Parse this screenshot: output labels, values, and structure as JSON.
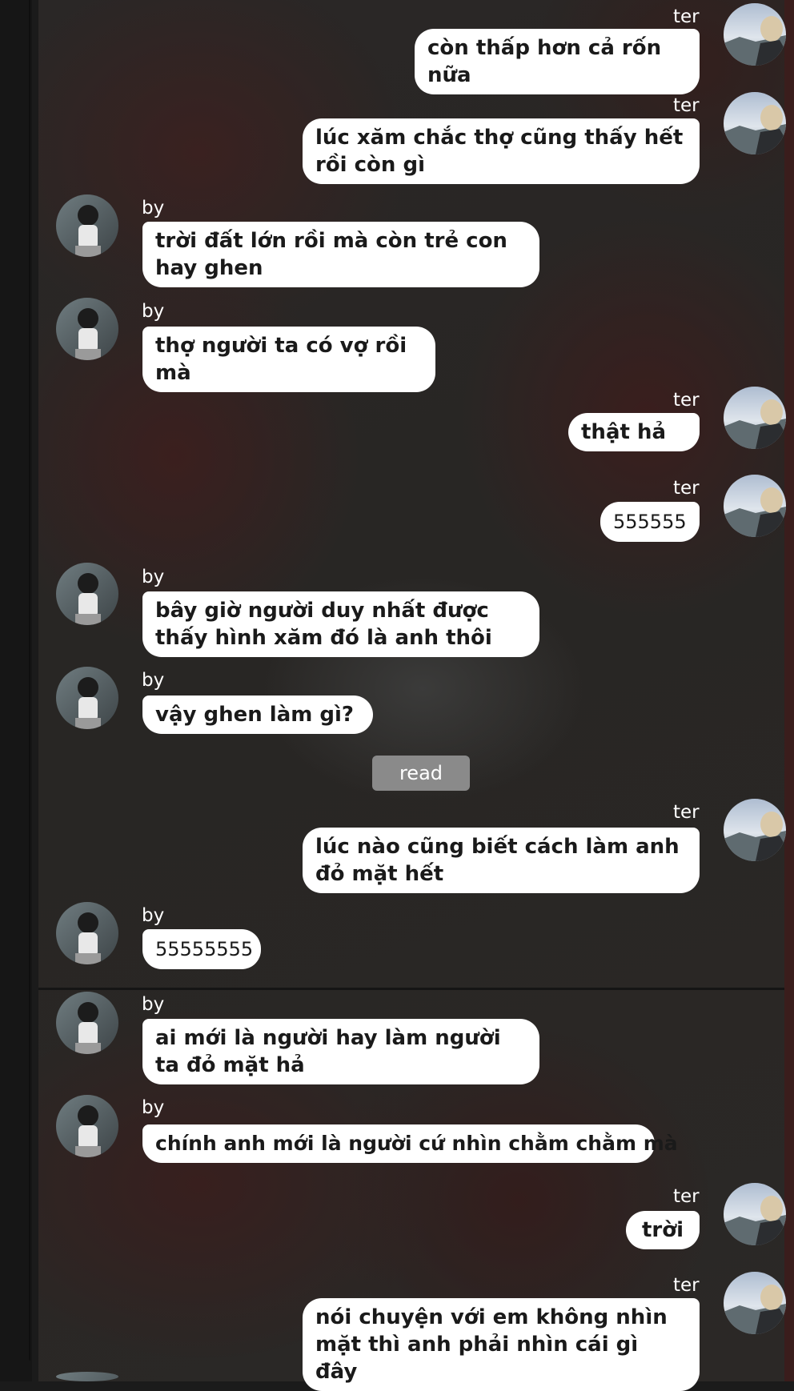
{
  "participants": {
    "left_name": "by",
    "right_name": "ter"
  },
  "messages": [
    {
      "side": "right",
      "name": "ter",
      "text": "còn thấp hơn cả rốn nữa"
    },
    {
      "side": "right",
      "name": "ter",
      "text": "lúc xăm chắc thợ cũng thấy hết rồi còn gì"
    },
    {
      "side": "left",
      "name": "by",
      "text": "trời đất lớn rồi mà còn trẻ con hay ghen"
    },
    {
      "side": "left",
      "name": "by",
      "text": "thợ người ta có vợ rồi mà"
    },
    {
      "side": "right",
      "name": "ter",
      "text": "thật hả"
    },
    {
      "side": "right",
      "name": "ter",
      "text": "555555"
    },
    {
      "side": "left",
      "name": "by",
      "text": "bây giờ người duy nhất được thấy hình xăm đó là anh thôi"
    },
    {
      "side": "left",
      "name": "by",
      "text": "vậy ghen làm gì?"
    },
    {
      "side": "right",
      "name": "ter",
      "text": "lúc nào cũng biết cách làm anh đỏ mặt hết"
    },
    {
      "side": "left",
      "name": "by",
      "text": "55555555"
    },
    {
      "side": "left",
      "name": "by",
      "text": "ai mới là người hay làm người ta đỏ mặt hả"
    },
    {
      "side": "left",
      "name": "by",
      "text": "chính anh mới là người cứ nhìn chằm chằm mà"
    },
    {
      "side": "right",
      "name": "ter",
      "text": "trời"
    },
    {
      "side": "right",
      "name": "ter",
      "text": "nói chuyện với em không nhìn mặt thì anh phải nhìn cái gì đây"
    }
  ],
  "read_receipt": "read",
  "colors": {
    "bubble": "#ffffff",
    "bubble_text": "#1a1a1a",
    "name_text": "#ffffff",
    "read_pill": "#8a8a8a"
  },
  "icons": {
    "left_avatar": "avatar-by-icon",
    "right_avatar": "avatar-ter-icon"
  }
}
